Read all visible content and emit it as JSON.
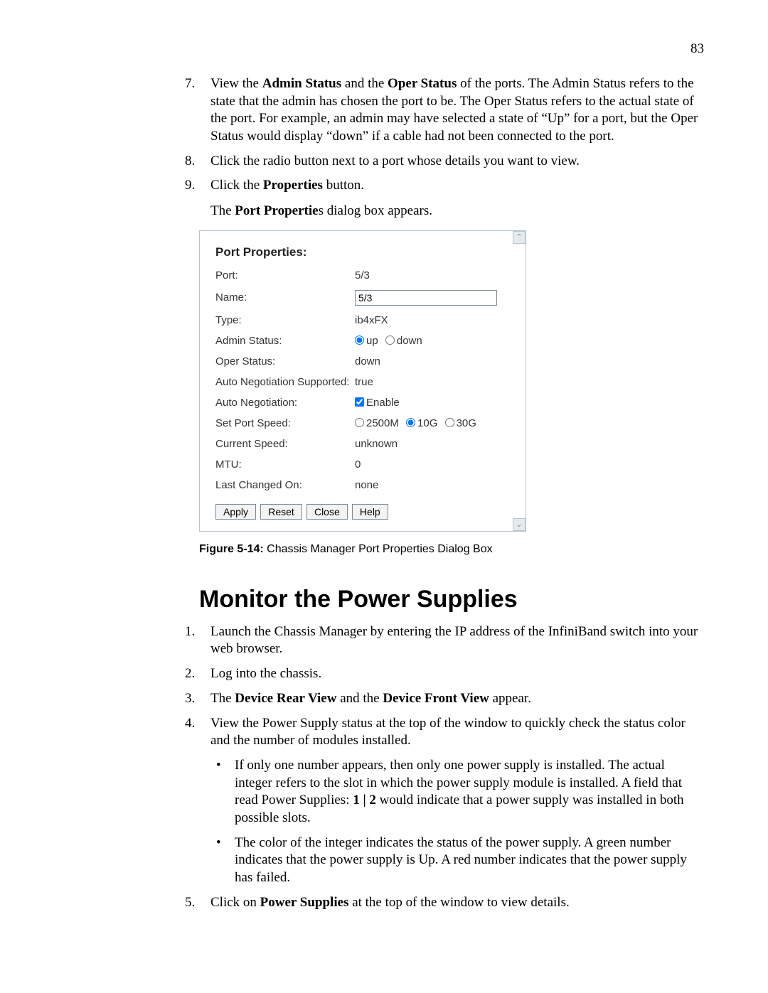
{
  "page_number": "83",
  "steps_top": [
    {
      "num": "7.",
      "html_parts": [
        "View the ",
        {
          "bold": "Admin Status"
        },
        " and the ",
        {
          "bold": "Oper Status"
        },
        " of the ports. The Admin Status refers to the state that the admin has chosen the port to be. The Oper Status refers to the actual state of the port. For example, an admin may have selected a state of “Up” for a port, but the Oper Status would display “down” if a cable had not been connected to the port."
      ]
    },
    {
      "num": "8.",
      "plain": "Click the radio button next to a port whose details you want to view."
    },
    {
      "num": "9.",
      "html_parts": [
        "Click the ",
        {
          "bold": "Properties"
        },
        " button."
      ]
    }
  ],
  "step9_sub": [
    "The ",
    {
      "bold": "Port Propertie"
    },
    "s dialog box appears."
  ],
  "dialog": {
    "title": "Port Properties:",
    "rows": {
      "port_label": "Port:",
      "port_value": "5/3",
      "name_label": "Name:",
      "name_value": "5/3",
      "type_label": "Type:",
      "type_value": "ib4xFX",
      "admin_label": "Admin Status:",
      "admin_up": "up",
      "admin_down": "down",
      "oper_label": "Oper Status:",
      "oper_value": "down",
      "autosup_label": "Auto Negotiation Supported:",
      "autosup_value": "true",
      "auton_label": "Auto Negotiation:",
      "auton_enable": "Enable",
      "speed_label": "Set Port Speed:",
      "speed_2500": "2500M",
      "speed_10g": "10G",
      "speed_30g": "30G",
      "cur_label": "Current Speed:",
      "cur_value": "unknown",
      "mtu_label": "MTU:",
      "mtu_value": "0",
      "last_label": "Last Changed On:",
      "last_value": "none"
    },
    "buttons": {
      "apply": "Apply",
      "reset": "Reset",
      "close": "Close",
      "help": "Help"
    },
    "scroll_up": "⌃",
    "scroll_down": "⌄"
  },
  "figure_caption_bold": "Figure 5-14:",
  "figure_caption_rest": " Chassis Manager Port Properties Dialog Box",
  "section_title": "Monitor the Power Supplies",
  "steps_bottom": [
    {
      "num": "1.",
      "plain": "Launch the Chassis Manager by entering the IP address of the InfiniBand switch into your web browser."
    },
    {
      "num": "2.",
      "plain": "Log into the chassis."
    },
    {
      "num": "3.",
      "html_parts": [
        "The ",
        {
          "bold": "Device Rear View"
        },
        " and the ",
        {
          "bold": "Device Front View"
        },
        " appear."
      ]
    },
    {
      "num": "4.",
      "plain": "View the Power Supply status at the top of the window to quickly check the status color and the number of modules installed."
    }
  ],
  "bullets": [
    [
      "If only one number appears, then only one power supply is installed. The actual integer refers to the slot in which the power supply module is installed. A field that read Power Supplies: ",
      {
        "bold": "1 | 2"
      },
      " would indicate that a power supply was installed in both possible slots."
    ],
    [
      "The color of the integer indicates the status of the power supply. A green number indicates that the power supply is Up. A red number indicates that the power supply has failed."
    ]
  ],
  "step5": {
    "num": "5.",
    "html_parts": [
      "Click on ",
      {
        "bold": "Power Supplies"
      },
      " at the top of the window to view details."
    ]
  }
}
